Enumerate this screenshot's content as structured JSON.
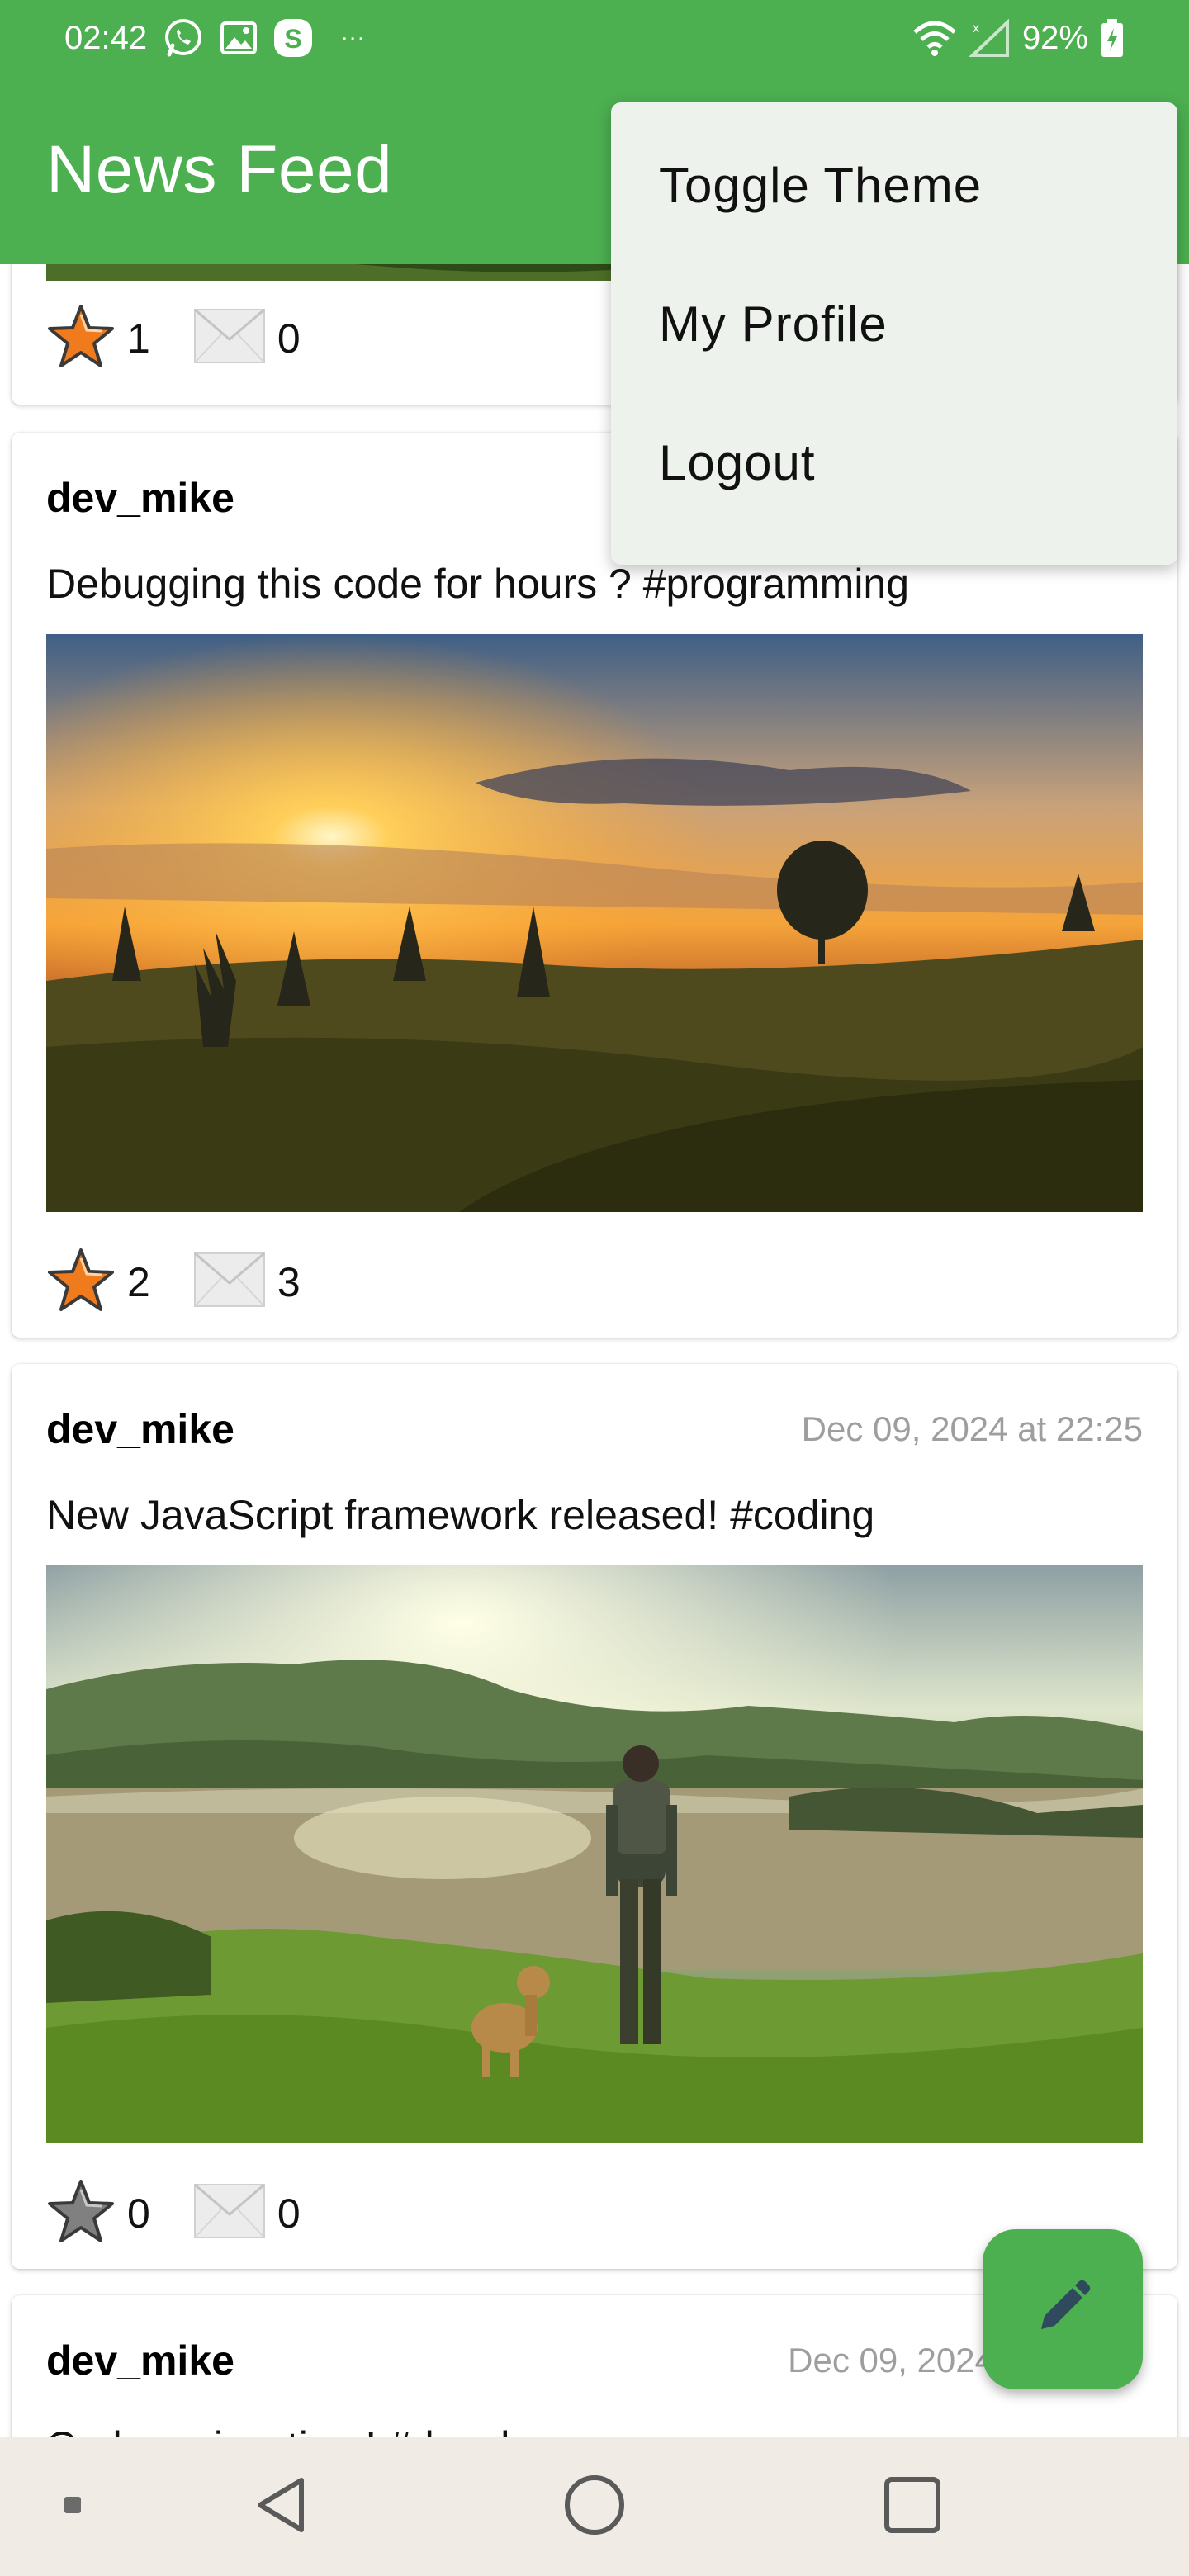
{
  "status_bar": {
    "time": "02:42",
    "battery": "92%",
    "more": "···",
    "notification_icons": [
      "whatsapp-icon",
      "gallery-icon",
      "skype-icon"
    ],
    "system_icons": [
      "wifi-icon",
      "signal-icon",
      "battery-icon"
    ]
  },
  "toolbar": {
    "title": "News Feed"
  },
  "overflow_menu": {
    "items": [
      {
        "label": "Toggle Theme"
      },
      {
        "label": "My Profile"
      },
      {
        "label": "Logout"
      }
    ]
  },
  "posts": [
    {
      "username": "",
      "timestamp": "",
      "text": "",
      "likes": "1",
      "comments": "0",
      "liked": true
    },
    {
      "username": "dev_mike",
      "timestamp": "",
      "text": "Debugging this code for hours ? #programming",
      "likes": "2",
      "comments": "3",
      "liked": true,
      "image": "sunset-landscape"
    },
    {
      "username": "dev_mike",
      "timestamp": "Dec 09, 2024 at 22:25",
      "text": "New JavaScript framework released! #coding",
      "likes": "0",
      "comments": "0",
      "liked": false,
      "image": "hiker-with-dog-at-lake"
    },
    {
      "username": "dev_mike",
      "timestamp": "Dec 09, 2024",
      "text": "Code review time! #developer"
    }
  ],
  "fab": {
    "icon": "pencil-icon"
  },
  "colors": {
    "primary": "#4caf50",
    "menu_background": "#eef2ec",
    "timestamp": "#9e9e9e",
    "star_active": "#f07b1d",
    "star_inactive": "#808080",
    "fab_icon": "#2f4a5c",
    "nav_background": "#f1ebe6"
  }
}
